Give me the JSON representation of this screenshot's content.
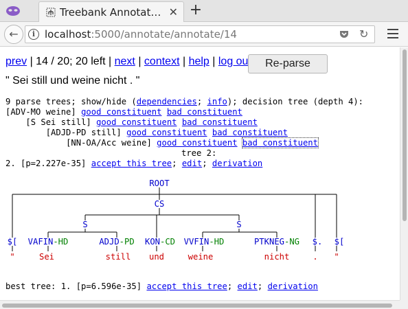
{
  "browser": {
    "tab_title": "Treebank Annotat…",
    "url_host": "localhost",
    "url_rest": ":5000/annotate/annotate/14"
  },
  "nav": {
    "prev": "prev",
    "sep1": " | ",
    "position": "14 / 20; 20 left",
    "sep2": " | ",
    "next": "next",
    "sep3": " | ",
    "context": "context",
    "sep4": " | ",
    "help": "help",
    "sep5": " | ",
    "logout": "log out",
    "reparse": "Re-parse"
  },
  "sentence": "\" Sei still und weine nicht . \"",
  "info_line": {
    "prefix": "9 parse trees; show/hide (",
    "dependencies": "dependencies",
    "semi": "; ",
    "info": "info",
    "suffix": "); decision tree (depth 4):"
  },
  "decision_tree": [
    {
      "indent": "",
      "label": "[ADV-MO weine]",
      "good": "good constituent",
      "bad": "bad constituent"
    },
    {
      "indent": "    ",
      "label": "[S Sei still]",
      "good": "good constituent",
      "bad": "bad constituent"
    },
    {
      "indent": "        ",
      "label": "[ADJD-PD still]",
      "good": "good constituent",
      "bad": "bad constituent"
    },
    {
      "indent": "            ",
      "label": "[NN-OA/Acc weine]",
      "good": "good constituent",
      "bad": "bad constituent"
    }
  ],
  "tree2_label": "tree 2:",
  "candidate": {
    "prefix": "2. [p=2.227e-35] ",
    "accept": "accept this tree",
    "semi1": "; ",
    "edit": "edit",
    "semi2": "; ",
    "derivation": "derivation"
  },
  "best": {
    "prefix": "best tree: 1. [p=6.596e-35] ",
    "accept": "accept this tree",
    "semi1": "; ",
    "edit": "edit",
    "semi2": "; ",
    "derivation": "derivation"
  },
  "tree": {
    "root": "ROOT",
    "cs": "CS",
    "s_left": "S",
    "s_right": "S",
    "preterminals": [
      {
        "cat": "$[",
        "func": ""
      },
      {
        "cat": "VAFIN",
        "func": "-HD"
      },
      {
        "cat": "ADJD",
        "func": "-PD"
      },
      {
        "cat": "KON",
        "func": "-CD"
      },
      {
        "cat": "VVFIN",
        "func": "-HD"
      },
      {
        "cat": "PTKNEG",
        "func": "-NG"
      },
      {
        "cat": "$.",
        "func": ""
      },
      {
        "cat": "$[",
        "func": ""
      }
    ],
    "words": [
      "\"",
      "Sei",
      "still",
      "und",
      "weine",
      "nicht",
      ".",
      "\""
    ]
  },
  "colors": {
    "link": "#0000ee",
    "category": "#0000cc",
    "function": "#008000",
    "word": "#cc0000"
  }
}
